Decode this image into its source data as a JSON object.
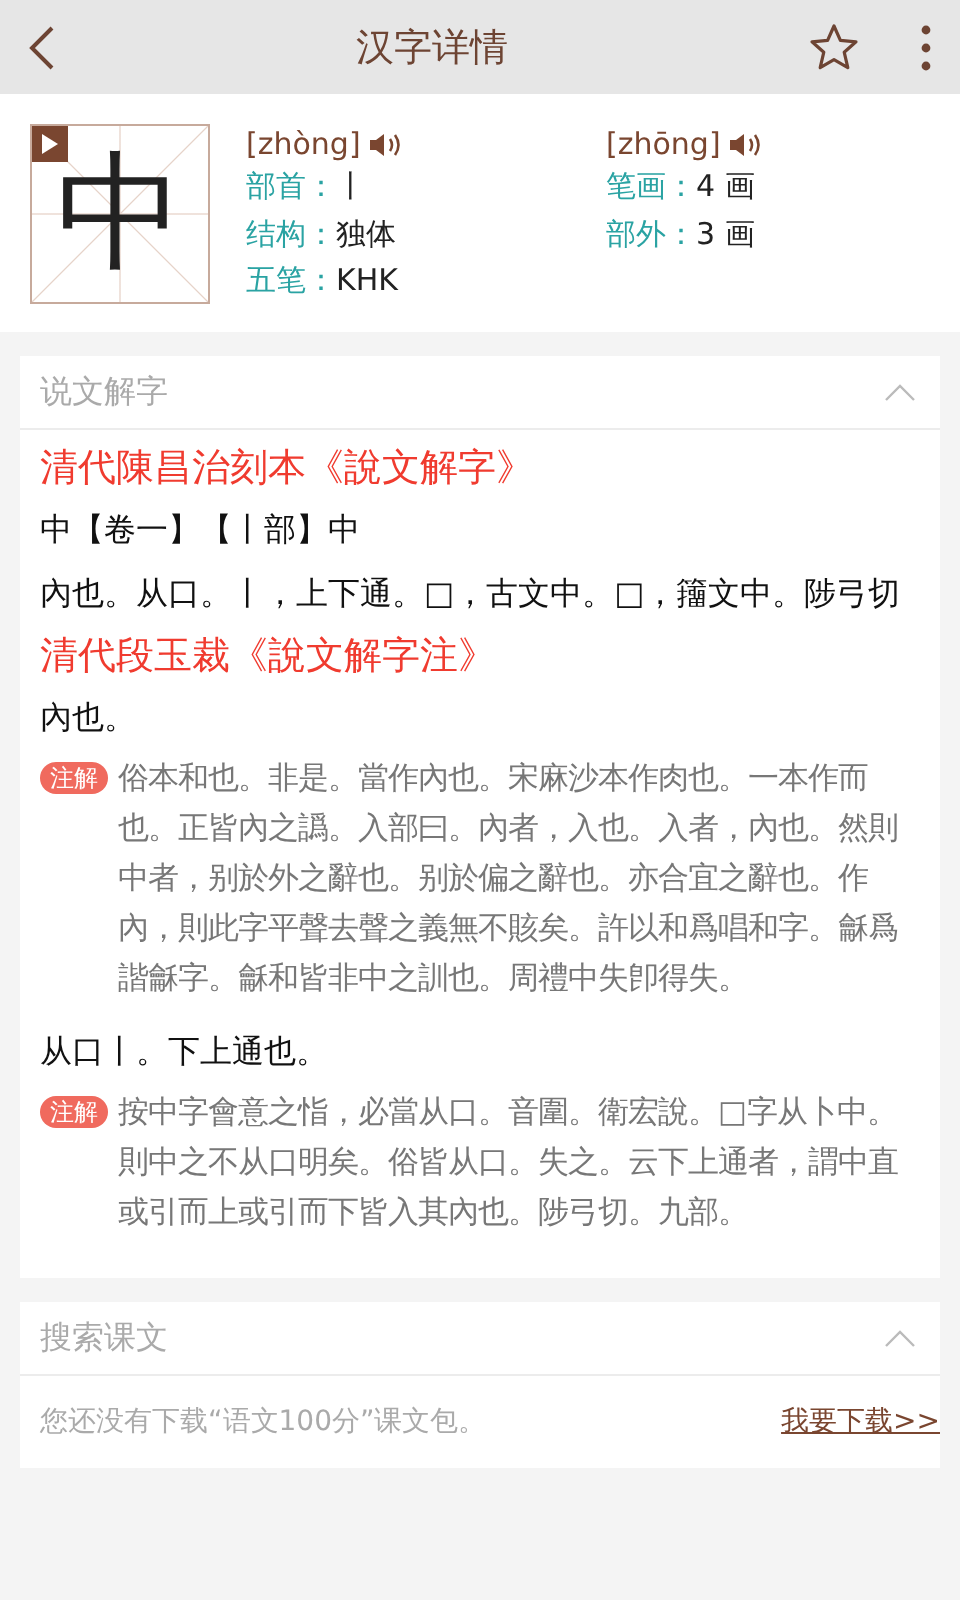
{
  "top_bar": {
    "title": "汉字详情",
    "favorite": false
  },
  "character": {
    "glyph": "中",
    "readings": [
      {
        "pinyin": "[zhòng]"
      },
      {
        "pinyin": "[zhōng]"
      }
    ],
    "fields": [
      {
        "label": "部首：",
        "value": "丨"
      },
      {
        "label": "笔画：",
        "value": "4 画"
      },
      {
        "label": "结构：",
        "value": "独体"
      },
      {
        "label": "部外：",
        "value": "3 画"
      },
      {
        "label": "五笔：",
        "value": "KHK"
      }
    ]
  },
  "shuowen": {
    "title": "说文解字",
    "expanded": true,
    "blocks": [
      {
        "kind": "heading",
        "text": "清代陳昌治刻本《說文解字》"
      },
      {
        "kind": "text",
        "text": "中【卷一】【丨部】中"
      },
      {
        "kind": "text",
        "text": "內也。从口。丨，上下通。□，古文中。□，籒文中。陟弓切"
      },
      {
        "kind": "heading",
        "text": "清代段玉裁《說文解字注》"
      },
      {
        "kind": "text",
        "text": "內也。"
      },
      {
        "kind": "note",
        "badge": "注解",
        "text": "俗本和也。非是。當作內也。宋麻沙本作肉也。一本作而也。正皆內之譌。入部曰。內者，入也。入者，內也。然則中者，别於外之辭也。别於偏之辭也。亦合宜之辭也。作內，則此字平聲去聲之義無不賅矣。許以和爲唱和字。龢爲諧龢字。龢和皆非中之訓也。周禮中失卽得失。"
      },
      {
        "kind": "text",
        "text": "从口丨。下上通也。"
      },
      {
        "kind": "note",
        "badge": "注解",
        "text": "按中字會意之恉，必當从口。音圍。衛宏說。□字从卜中。則中之不从口明矣。俗皆从口。失之。云下上通者，謂中直或引而上或引而下皆入其內也。陟弓切。九部。"
      }
    ]
  },
  "texts": {
    "title": "搜索课文",
    "expanded": true,
    "message": "您还没有下载“语文100分”课文包。",
    "link": "我要下载>>"
  }
}
